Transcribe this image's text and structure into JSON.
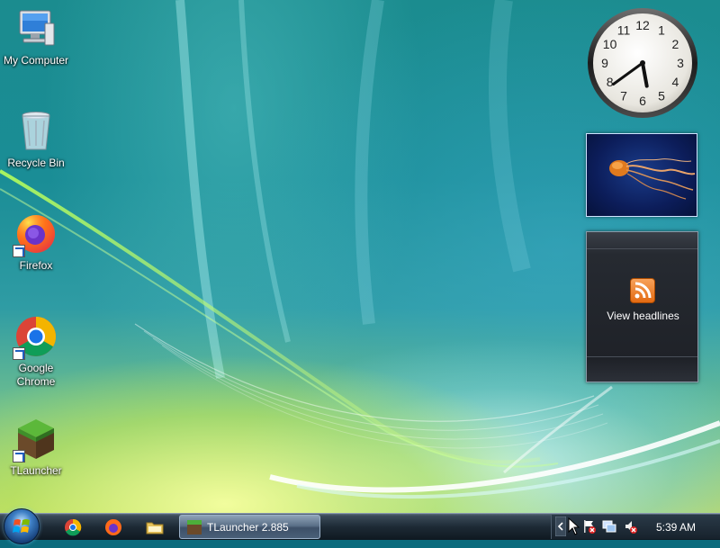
{
  "desktop": {
    "icons": [
      {
        "label": "My Computer"
      },
      {
        "label": "Recycle Bin"
      },
      {
        "label": "Firefox"
      },
      {
        "label": "Google Chrome"
      },
      {
        "label": "TLauncher"
      }
    ]
  },
  "gadgets": {
    "clock": {
      "numbers": [
        "12",
        "1",
        "2",
        "3",
        "4",
        "5",
        "6",
        "7",
        "8",
        "9",
        "10",
        "11"
      ],
      "time_hours": 5,
      "time_minutes": 39
    },
    "slideshow": {
      "subject": "jellyfish-photo"
    },
    "feed": {
      "headlines_label": "View headlines"
    }
  },
  "taskbar": {
    "start_icon": "windows-orb-icon",
    "quick_launch": [
      "chrome-icon",
      "firefox-icon",
      "folder-icon"
    ],
    "tasks": [
      {
        "label": "TLauncher 2.885",
        "icon": "tlauncher-icon"
      }
    ],
    "tray_icons": [
      "show-hidden-icons-icon",
      "flag-icon",
      "network-icon",
      "volume-icon"
    ],
    "clock": "5:39 AM"
  },
  "colors": {
    "accent": "#1f5fbf",
    "rss": "#e36a12"
  }
}
